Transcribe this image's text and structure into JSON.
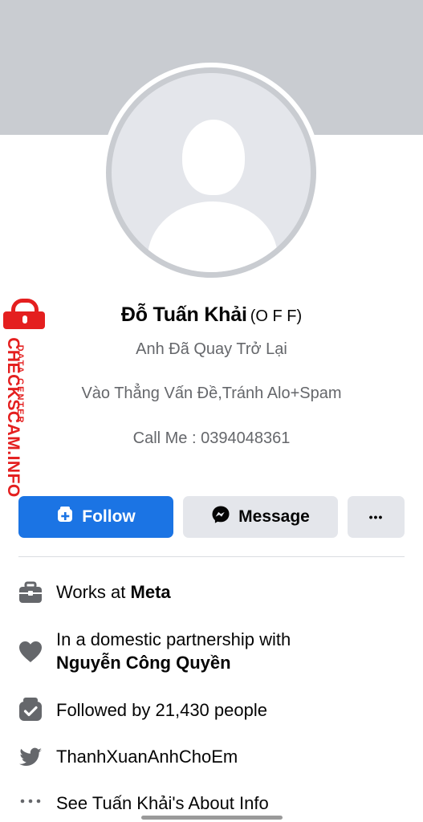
{
  "profile": {
    "name": "Đỗ Tuấn Khải",
    "alt_name": "(O F F)",
    "bio": [
      "Anh Đã Quay Trở Lại",
      "Vào Thẳng Vấn Đề,Tránh Alo+Spam",
      "Call Me : 0394048361"
    ]
  },
  "watermark": {
    "site": "CHECKSCAM.INFO",
    "tag": "DATA CENTER",
    "color": "#e41f1f"
  },
  "actions": {
    "follow_label": "Follow",
    "message_label": "Message",
    "more_label": "•••"
  },
  "info": {
    "work_prefix": "Works at",
    "work_place": "Meta",
    "relationship_prefix": "In a domestic partnership with",
    "relationship_partner": "Nguyễn Công Quyền",
    "followers": "Followed by 21,430 people",
    "twitter": "ThanhXuanAnhChoEm",
    "about": "See Tuấn Khải's About Info"
  },
  "colors": {
    "accent": "#1b74e4",
    "icon_gray": "#65676b",
    "button_gray": "#e4e6eb"
  }
}
